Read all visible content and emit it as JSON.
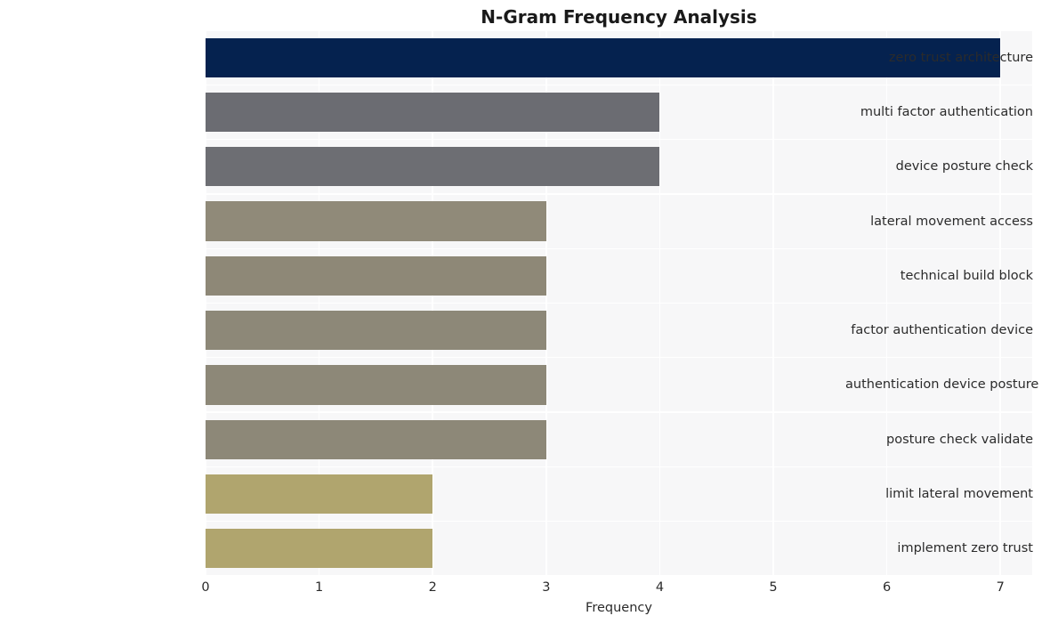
{
  "chart_data": {
    "type": "bar",
    "orientation": "horizontal",
    "title": "N-Gram Frequency Analysis",
    "xlabel": "Frequency",
    "ylabel": "",
    "categories": [
      "zero trust architecture",
      "multi factor authentication",
      "device posture check",
      "lateral movement access",
      "technical build block",
      "factor authentication device",
      "authentication device posture",
      "posture check validate",
      "limit lateral movement",
      "implement zero trust"
    ],
    "values": [
      7,
      4,
      4,
      3,
      3,
      3,
      3,
      3,
      2,
      2
    ],
    "bar_colors": [
      "#05224f",
      "#6b6c72",
      "#6d6e73",
      "#908a79",
      "#8e8877",
      "#8d8878",
      "#8d8878",
      "#8d8878",
      "#b0a56e",
      "#b0a56e"
    ],
    "xlim": [
      0,
      7.28
    ],
    "xticks": [
      0,
      1,
      2,
      3,
      4,
      5,
      6,
      7
    ],
    "xtick_labels": [
      "0",
      "1",
      "2",
      "3",
      "4",
      "5",
      "6",
      "7"
    ],
    "grid": true,
    "grid_color": "#ffffff",
    "plot_background": "#f7f7f8",
    "figure_background": "#ffffff",
    "legend": null,
    "annotations": []
  }
}
